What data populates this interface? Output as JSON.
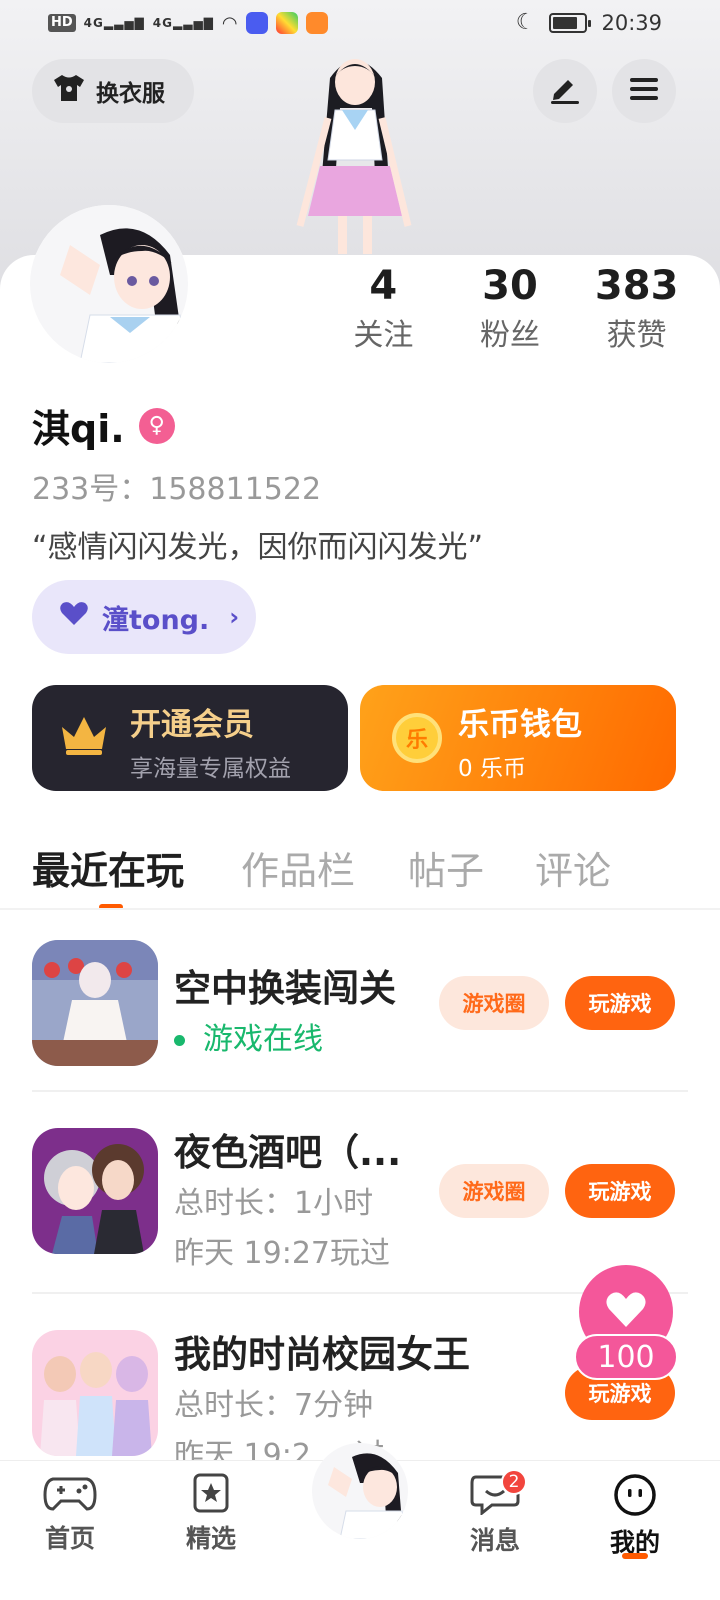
{
  "status_bar": {
    "hd": "HD",
    "sim": "2",
    "signal1": "4G",
    "signal2": "4G",
    "time": "20:39"
  },
  "header": {
    "change_outfit_label": "换衣服",
    "edit_icon": "pencil-icon",
    "menu_icon": "menu-icon"
  },
  "profile": {
    "stats": [
      {
        "value": "4",
        "label": "关注"
      },
      {
        "value": "30",
        "label": "粉丝"
      },
      {
        "value": "383",
        "label": "获赞"
      }
    ],
    "name": "淇qi.",
    "gender_icon": "female-icon",
    "uid": "233号：158811522",
    "bio": "“感情闪闪发光，因你而闪闪发光”",
    "tag": "潼tong."
  },
  "promo": {
    "vip_title": "开通会员",
    "vip_sub": "享海量专属权益",
    "wallet_title": "乐币钱包",
    "wallet_sub": "0 乐币",
    "coin_text": "乐"
  },
  "tabs": [
    "最近在玩",
    "作品栏",
    "帖子",
    "评论"
  ],
  "games": [
    {
      "name": "空中换装闯关",
      "line1": "游戏在线",
      "line2": "",
      "circle": "游戏圈",
      "play": "玩游戏"
    },
    {
      "name": "夜色酒吧（...",
      "line1": "总时长：1小时",
      "line2": "昨天 19:27玩过",
      "circle": "游戏圈",
      "play": "玩游戏"
    },
    {
      "name": "我的时尚校园女王",
      "line1": "总时长：7分钟",
      "line2": "昨天 19:2",
      "line2_tail": "过",
      "play": "玩游戏"
    }
  ],
  "float": {
    "count": "100"
  },
  "nav": {
    "home": "首页",
    "featured": "精选",
    "messages": "消息",
    "messages_badge": "2",
    "mine": "我的"
  },
  "colors": {
    "accent": "#ff6410",
    "pink": "#f4579a",
    "online": "#19b86d"
  }
}
